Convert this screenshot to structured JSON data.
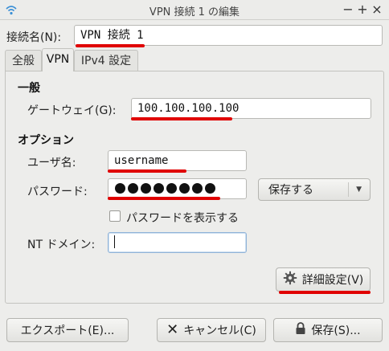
{
  "window": {
    "title": "VPN 接続 1 の編集",
    "controls": [
      "minimize",
      "maximize",
      "close"
    ]
  },
  "connection": {
    "name_label": "接続名(N):",
    "name_value": "VPN 接続 1"
  },
  "tabs": [
    {
      "label": "全般",
      "active": false
    },
    {
      "label": "VPN",
      "active": true
    },
    {
      "label": "IPv4 設定",
      "active": false
    }
  ],
  "general": {
    "heading": "一般",
    "gateway_label": "ゲートウェイ(G):",
    "gateway_value": "100.100.100.100"
  },
  "options": {
    "heading": "オプション",
    "username_label": "ユーザ名:",
    "username_value": "username",
    "password_label": "パスワード:",
    "password_mask_count": 8,
    "password_store_option": "保存する",
    "show_password_label": "パスワードを表示する",
    "show_password_checked": false,
    "nt_domain_label": "NT ドメイン:",
    "nt_domain_value": "",
    "advanced_button": "詳細設定(V)"
  },
  "footer": {
    "export_button": "エクスポート(E)...",
    "cancel_button": "キャンセル(C)",
    "save_button": "保存(S)..."
  },
  "colors": {
    "annotation_underline": "#e00000",
    "window_bg": "#ededeb",
    "focus_border": "#8fb3d8"
  }
}
